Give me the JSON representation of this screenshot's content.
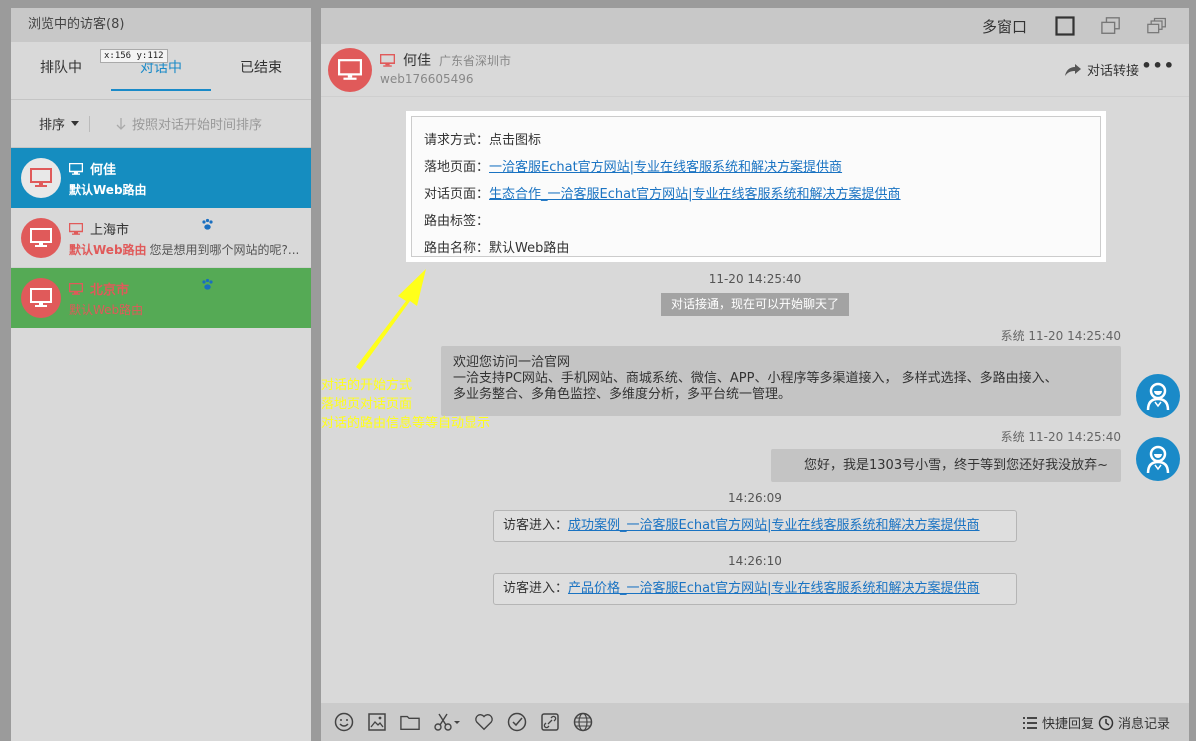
{
  "left": {
    "header": "浏览中的访客(8)",
    "tabs": [
      {
        "label": "排队中"
      },
      {
        "label": "对话中"
      },
      {
        "label": "已结束"
      }
    ],
    "coord_tip": "x:156 y:112",
    "sort_label": "排序",
    "sort_hint": "按照对话开始时间排序",
    "visitors": [
      {
        "name": "何佳",
        "route": "默认Web路由",
        "message": ""
      },
      {
        "name": "上海市",
        "route": "默认Web路由",
        "message": "您是想用到哪个网站的呢?..."
      },
      {
        "name": "北京市",
        "route": "默认Web路由",
        "message": ""
      }
    ]
  },
  "topbar": {
    "multi_window": "多窗口"
  },
  "chat_header": {
    "name": "何佳",
    "location": "广东省深圳市",
    "visitor_id": "web176605496",
    "transfer": "对话转接",
    "more": "•••"
  },
  "info_card": {
    "rows": [
      {
        "label": "请求方式：",
        "value": "点击图标"
      },
      {
        "label": "落地页面：",
        "value": "一洽客服Echat官方网站|专业在线客服系统和解决方案提供商"
      },
      {
        "label": "对话页面：",
        "value": "生态合作_一洽客服Echat官方网站|专业在线客服系统和解决方案提供商"
      },
      {
        "label": "路由标签：",
        "value": ""
      },
      {
        "label": "路由名称：",
        "value": "默认Web路由"
      }
    ]
  },
  "messages": {
    "ts1": "11-20 14:25:40",
    "notice": "对话接通，现在可以开始聊天了",
    "msg1_meta": "系统  11-20 14:25:40",
    "msg1_line1": "欢迎您访问一洽官网",
    "msg1_line2": "一洽支持PC网站、手机网站、商城系统、微信、APP、小程序等多渠道接入， 多样式选择、多路由接入、",
    "msg1_line3": "多业务整合、多角色监控、多维度分析，多平台统一管理。",
    "msg2_meta": "系统  11-20 14:25:40",
    "msg2_text": "您好，我是1303号小雪，终于等到您还好我没放弃~",
    "ts2": "14:26:09",
    "visit1_label": "访客进入：",
    "visit1_link": "成功案例_一洽客服Echat官方网站|专业在线客服系统和解决方案提供商",
    "ts3": "14:26:10",
    "visit2_label": "访客进入：",
    "visit2_link": "产品价格_一洽客服Echat官方网站|专业在线客服系统和解决方案提供商"
  },
  "annotation": {
    "line1": "对话的开始方式",
    "line2": "落地页对话页面",
    "line3": "对话的路由信息等等自动显示",
    "color": "#ffff1a"
  },
  "toolbar": {
    "icons": [
      "emoji-icon",
      "image-icon",
      "folder-icon",
      "scissors-icon",
      "heart-icon",
      "check-circle-icon",
      "link-icon",
      "globe-icon"
    ],
    "quick_reply": "快捷回复",
    "history": "消息记录"
  },
  "colors": {
    "accent": "#1a8ac8",
    "active_row": "#158dc0",
    "green_row": "#55aa55",
    "avatar_red": "#e05a5a",
    "link": "#1a73c2"
  }
}
